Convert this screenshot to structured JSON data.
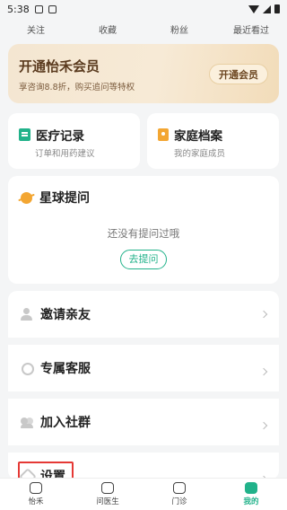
{
  "status": {
    "time": "5:38"
  },
  "stats": {
    "items": [
      "关注",
      "收藏",
      "粉丝",
      "最近看过"
    ]
  },
  "vip": {
    "title": "开通怡禾会员",
    "subtitle": "享咨询8.8折，购买追问等特权",
    "button": "开通会员"
  },
  "cards": {
    "records": {
      "title": "医疗记录",
      "subtitle": "订单和用药建议"
    },
    "family": {
      "title": "家庭档案",
      "subtitle": "我的家庭成员"
    }
  },
  "qa": {
    "title": "星球提问",
    "empty": "还没有提问过哦",
    "button": "去提问"
  },
  "menu": {
    "invite": "邀请亲友",
    "service": "专属客服",
    "community": "加入社群",
    "settings": "设置"
  },
  "tabs": [
    {
      "label": "怡禾",
      "icon": "home-icon"
    },
    {
      "label": "问医生",
      "icon": "doctor-icon"
    },
    {
      "label": "门诊",
      "icon": "clinic-icon"
    },
    {
      "label": "我的",
      "icon": "profile-icon"
    }
  ],
  "colors": {
    "accent": "#21b28a",
    "gold": "#f3a632",
    "highlight": "#e53935"
  }
}
